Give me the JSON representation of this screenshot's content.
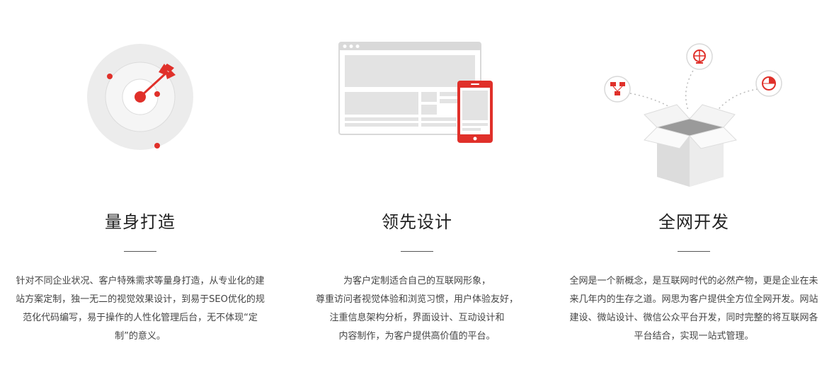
{
  "features": [
    {
      "title": "量身打造",
      "icon": "target-dart-icon",
      "lines": [
        "针对不同企业状况、客户特殊需求等量身打造，从专业化的建",
        "站方案定制，独一无二的视觉效果设计，到易于SEO优化的规",
        "范化代码编写，易于操作的人性化管理后台，无不体现“定",
        "制”的意义。"
      ]
    },
    {
      "title": "领先设计",
      "icon": "responsive-devices-icon",
      "lines": [
        "为客户定制适合自己的互联网形象，",
        "尊重访问者视觉体验和浏览习惯，用户体验友好，",
        "注重信息架构分析，界面设计、互动设计和",
        "内容制作，为客户提供高价值的平台。"
      ]
    },
    {
      "title": "全网开发",
      "icon": "open-box-network-icon",
      "lines": [
        "全网是一个新概念，是互联网时代的必然产物，更是企业在未",
        "来几年内的生存之道。网思为客户提供全方位全网开发。网站",
        "建设、微站设计、微信公众平台开发，同时完整的将互联网各",
        "平台结合，实现一站式管理。"
      ]
    }
  ],
  "colors": {
    "accent": "#e0302a",
    "gray": "#d9d9d9",
    "text": "#444444",
    "title": "#222222"
  }
}
